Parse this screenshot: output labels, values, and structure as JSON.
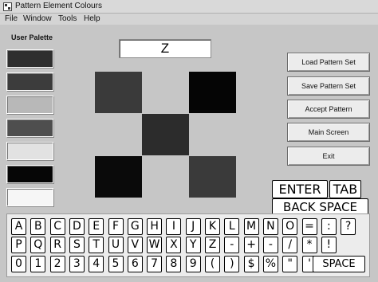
{
  "window": {
    "title": "Pattern Element Colours"
  },
  "menu": {
    "file": "File",
    "window": "Window",
    "tools": "Tools",
    "help": "Help"
  },
  "palette": {
    "title": "User Palette",
    "swatches": [
      "#2e2e2e",
      "#3c3c3c",
      "#b8b8b8",
      "#4e4e4e",
      "#e2e2e2",
      "#060606",
      "#f6f6f6"
    ]
  },
  "letter_display": {
    "value": "Z"
  },
  "pattern": {
    "colors": [
      "#3a3a3a",
      "#050505",
      "#2c2c2c",
      "#0a0a0a",
      "#3a3a3a"
    ]
  },
  "buttons": {
    "load": "Load Pattern Set",
    "save": "Save Pattern Set",
    "accept": "Accept Pattern",
    "main": "Main Screen",
    "exit": "Exit"
  },
  "keyboard": {
    "enter": "ENTER",
    "tab": "TAB",
    "backspace": "BACK SPACE",
    "space": "SPACE",
    "row1": [
      "A",
      "B",
      "C",
      "D",
      "E",
      "F",
      "G",
      "H",
      "I",
      "J",
      "K",
      "L",
      "M",
      "N",
      "O",
      "=",
      ":",
      "?"
    ],
    "row2": [
      "P",
      "Q",
      "R",
      "S",
      "T",
      "U",
      "V",
      "W",
      "X",
      "Y",
      "Z",
      "-",
      "+",
      "-",
      "/",
      "*",
      "!"
    ],
    "row3": [
      "0",
      "1",
      "2",
      "3",
      "4",
      "5",
      "6",
      "7",
      "8",
      "9",
      "(",
      ")",
      "$",
      "%",
      "\"",
      "'"
    ]
  }
}
